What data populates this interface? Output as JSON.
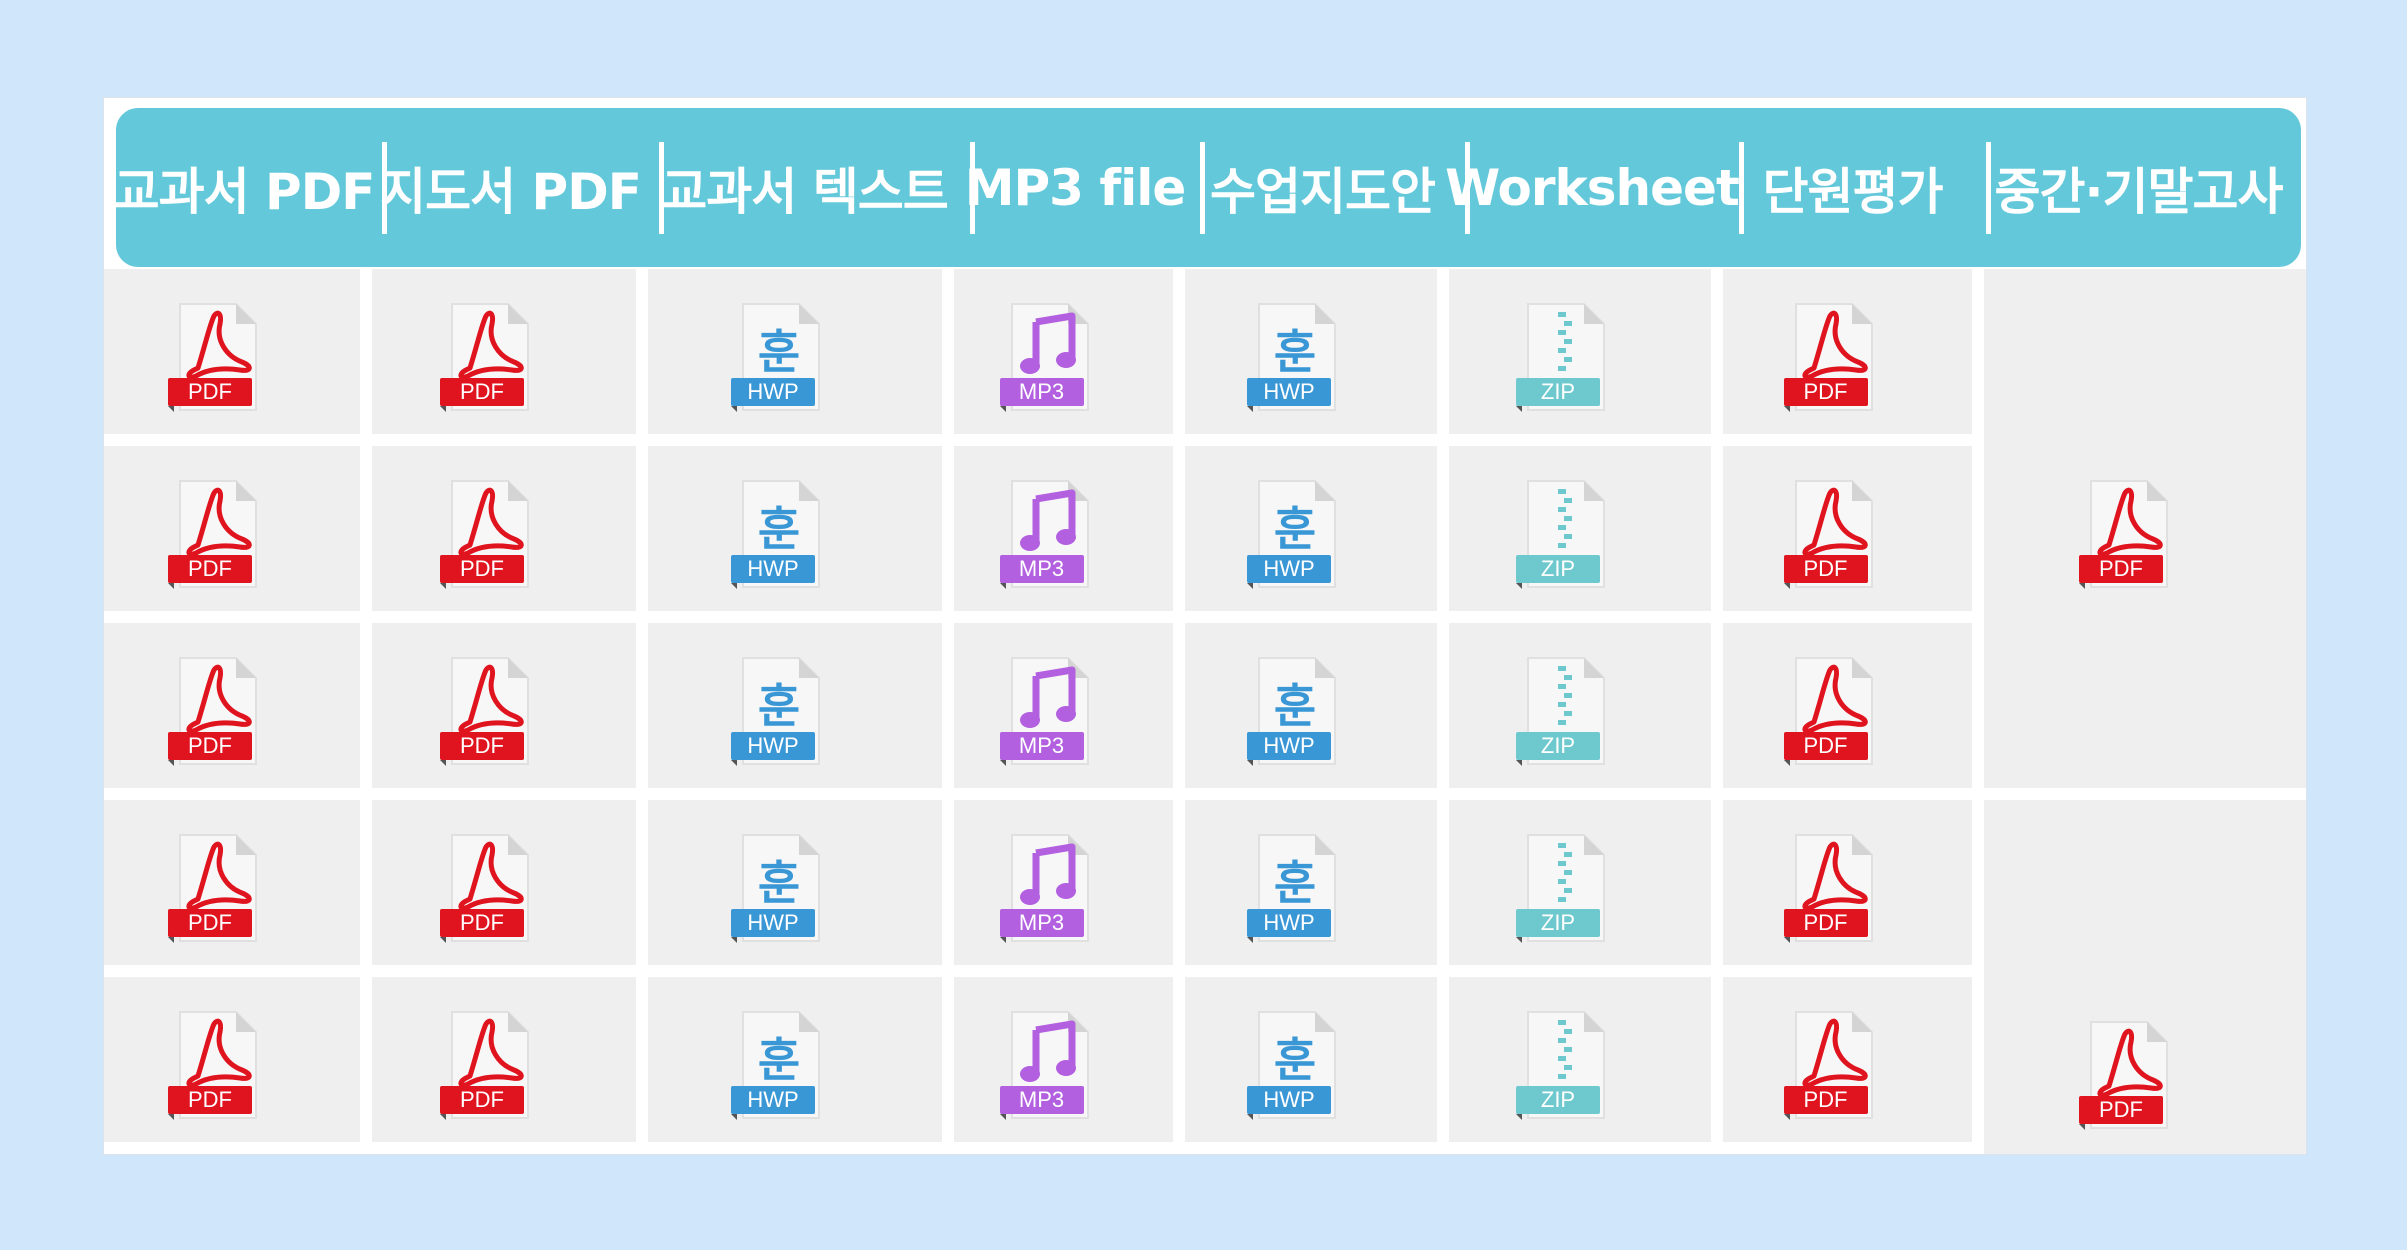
{
  "header": {
    "columns": [
      {
        "label": "교과서 PDF"
      },
      {
        "label": "지도서 PDF"
      },
      {
        "label": "교과서 텍스트"
      },
      {
        "label": "MP3 file"
      },
      {
        "label": "수업지도안"
      },
      {
        "label": "Worksheet"
      },
      {
        "label": "단원평가"
      },
      {
        "label": "중간·기말고사"
      }
    ]
  },
  "icon_types": {
    "pdf": {
      "badge": "PDF",
      "color": "#e0141e",
      "icon": "acrobat-icon"
    },
    "hwp": {
      "badge": "HWP",
      "color": "#3a97d6",
      "icon": "hangul-icon"
    },
    "mp3": {
      "badge": "MP3",
      "color": "#b25fe0",
      "icon": "music-note-icon"
    },
    "zip": {
      "badge": "ZIP",
      "color": "#6ec9cf",
      "icon": "zipper-icon"
    }
  },
  "rows": [
    [
      "pdf",
      "pdf",
      "hwp",
      "mp3",
      "hwp",
      "zip",
      "pdf"
    ],
    [
      "pdf",
      "pdf",
      "hwp",
      "mp3",
      "hwp",
      "zip",
      "pdf"
    ],
    [
      "pdf",
      "pdf",
      "hwp",
      "mp3",
      "hwp",
      "zip",
      "pdf"
    ],
    [
      "pdf",
      "pdf",
      "hwp",
      "mp3",
      "hwp",
      "zip",
      "pdf"
    ],
    [
      "pdf",
      "pdf",
      "hwp",
      "mp3",
      "hwp",
      "zip",
      "pdf"
    ]
  ],
  "exam_cells": [
    {
      "type": "pdf"
    },
    {
      "type": "pdf"
    }
  ]
}
